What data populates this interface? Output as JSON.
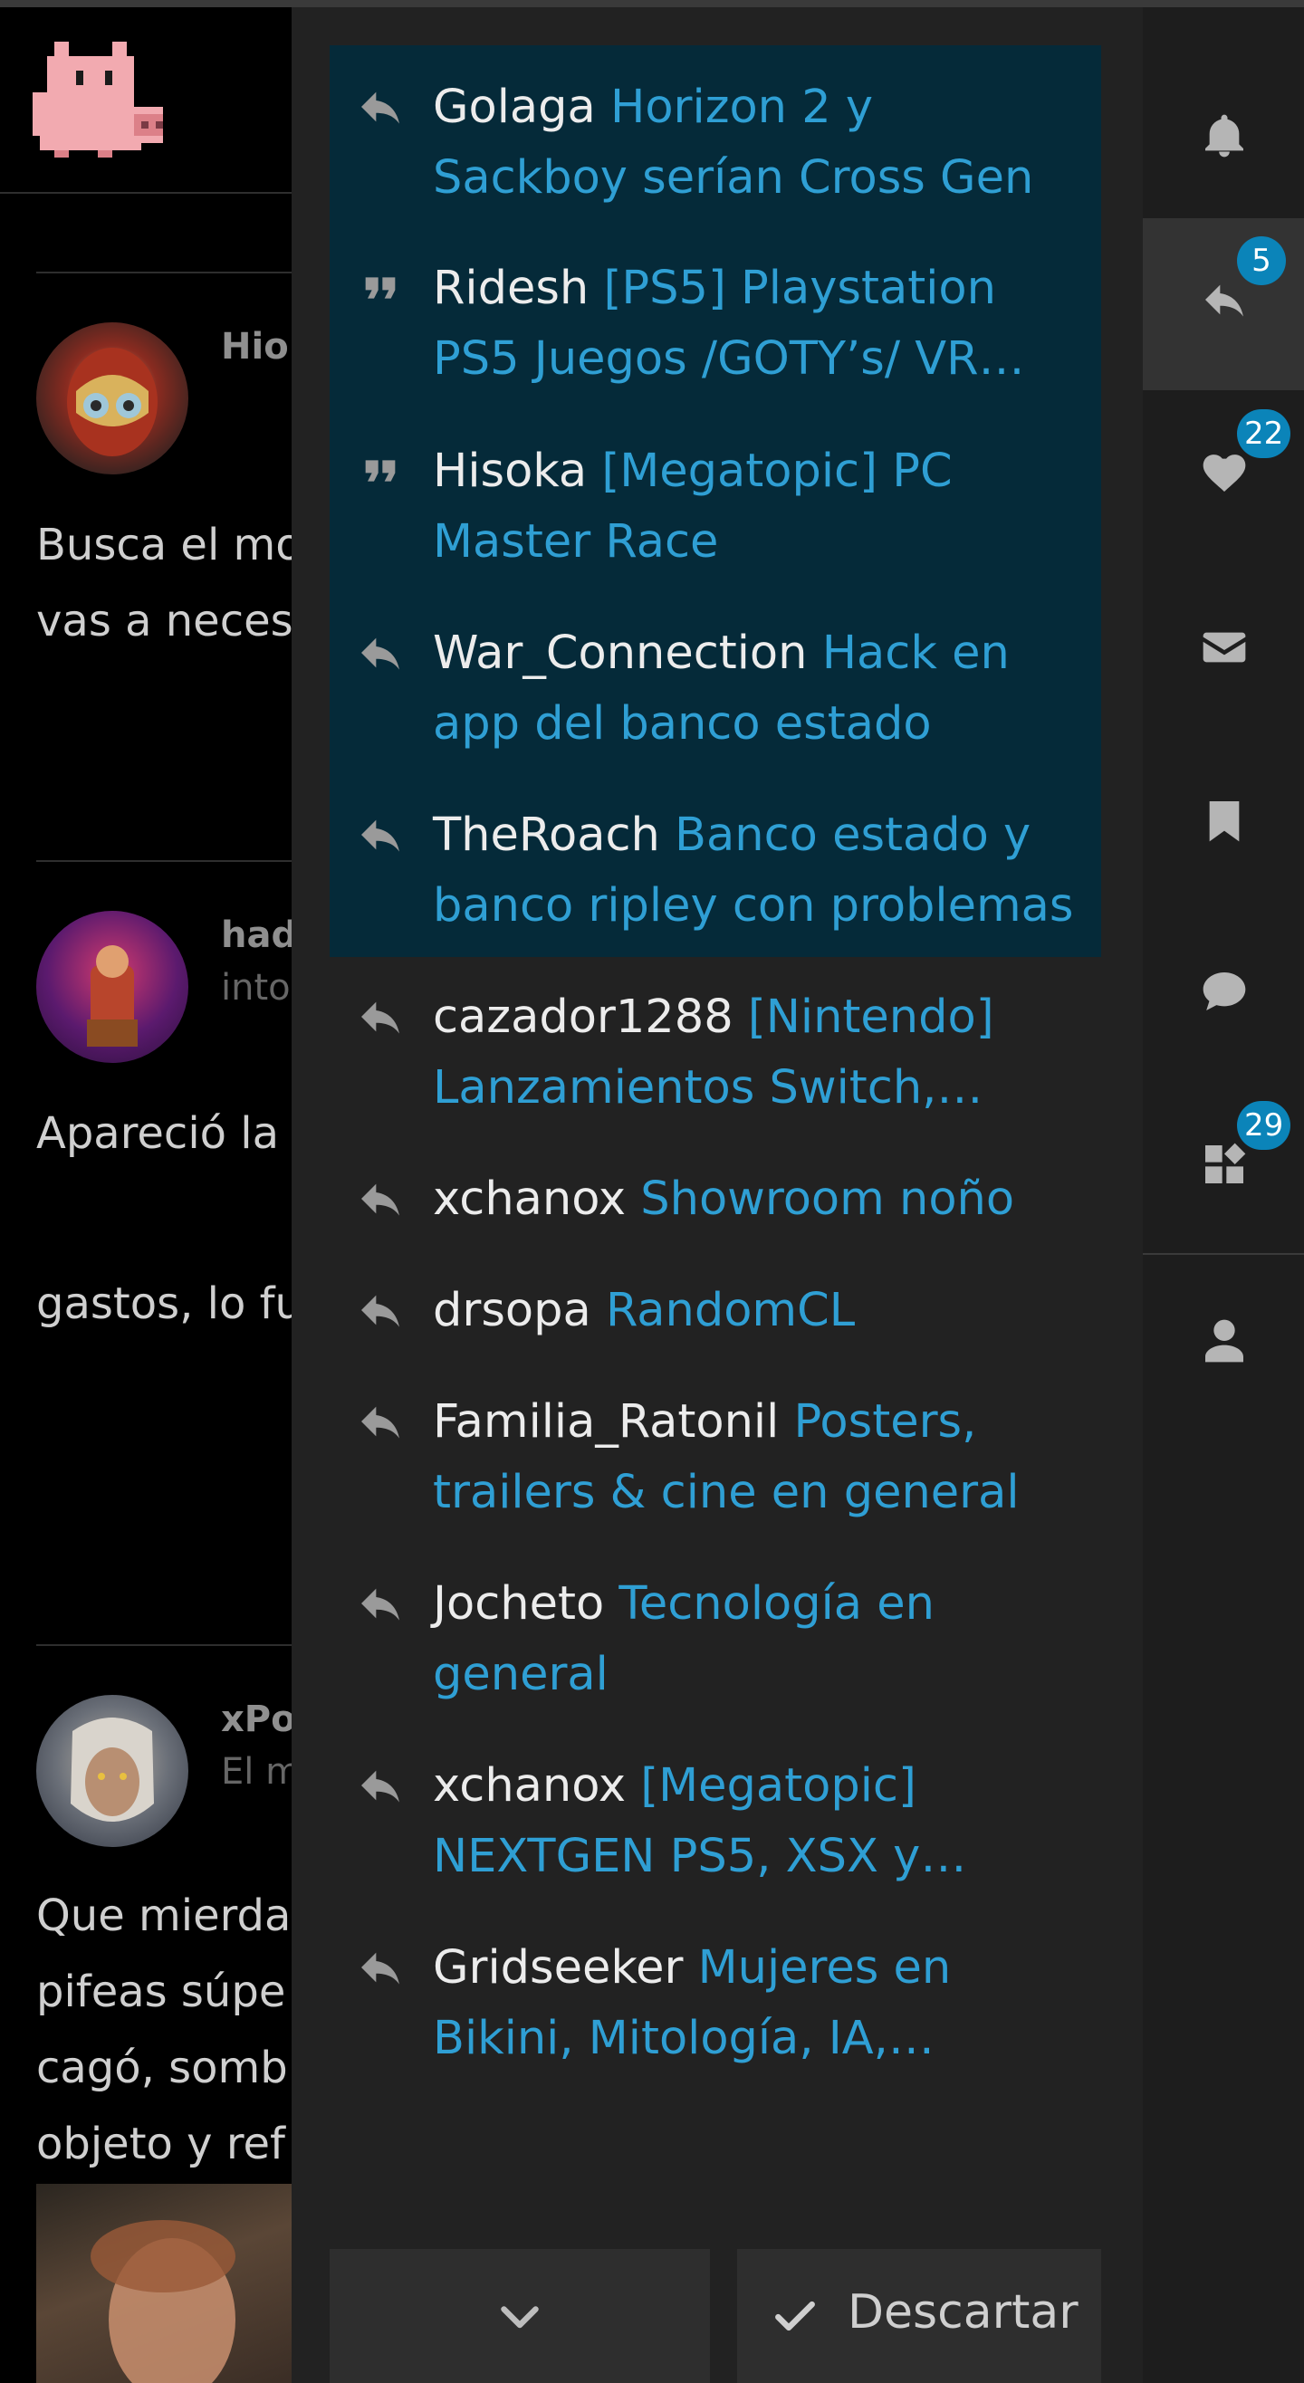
{
  "background": {
    "posts": [
      {
        "username": "Hio",
        "subtitle": "",
        "lines": [
          "Busca el mo",
          "vas a neces"
        ]
      },
      {
        "username": "had",
        "subtitle": "into",
        "lines": [
          "Apareció la",
          "",
          "gastos, lo fu"
        ]
      },
      {
        "username": "xPo",
        "subtitle": "El m",
        "lines": [
          "Que mierda",
          "pifeas súpe",
          "cagó, somb",
          "objeto y ref"
        ]
      }
    ]
  },
  "notifications": [
    {
      "icon": "reply-icon",
      "user": "Golaga",
      "topic": "Horizon 2 y Sackboy serían Cross Gen",
      "unread": true
    },
    {
      "icon": "quote-icon",
      "user": "Ridesh",
      "topic": "[PS5] Playstation",
      "topic2": "PS5 Juegos /GOTY’s/ VR…",
      "unread": true
    },
    {
      "icon": "quote-icon",
      "user": "Hisoka",
      "topic": "[Megatopic] PC Master Race",
      "unread": true
    },
    {
      "icon": "reply-icon",
      "user": "War_Connection",
      "topic": "Hack en app del banco estado",
      "unread": true
    },
    {
      "icon": "reply-icon",
      "user": "TheRoach",
      "topic": "Banco estado y banco ripley con problemas",
      "unread": true
    },
    {
      "icon": "reply-icon",
      "user": "cazador1288",
      "topic": "[Nintendo]",
      "topic2": "Lanzamientos Switch,…",
      "unread": false
    },
    {
      "icon": "reply-icon",
      "user": "xchanox",
      "topic": "Showroom noño",
      "unread": false
    },
    {
      "icon": "reply-icon",
      "user": "drsopa",
      "topic": "RandomCL",
      "unread": false
    },
    {
      "icon": "reply-icon",
      "user": "Familia_Ratonil",
      "topic": "Posters, trailers & cine en general",
      "unread": false
    },
    {
      "icon": "reply-icon",
      "user": "Jocheto",
      "topic": "Tecnología en general",
      "unread": false
    },
    {
      "icon": "reply-icon",
      "user": "xchanox",
      "topic": "[Megatopic]",
      "topic2": "NEXTGEN PS5, XSX y…",
      "unread": false
    },
    {
      "icon": "reply-icon",
      "user": "Gridseeker",
      "topic": "Mujeres en",
      "topic2": "Bikini, Mitología, IA,…",
      "unread": false
    }
  ],
  "footer": {
    "more_icon": "chevron-down-icon",
    "dismiss_label": "Descartar",
    "dismiss_icon": "check-icon"
  },
  "iconbar": [
    {
      "name": "notifications",
      "icon": "bell-icon",
      "badge": ""
    },
    {
      "name": "replies",
      "icon": "reply-icon",
      "badge": "5",
      "active": true
    },
    {
      "name": "likes",
      "icon": "heart-icon",
      "badge": "22"
    },
    {
      "name": "messages",
      "icon": "envelope-icon",
      "badge": ""
    },
    {
      "name": "bookmarks",
      "icon": "bookmark-icon",
      "badge": ""
    },
    {
      "name": "chat",
      "icon": "comment-icon",
      "badge": ""
    },
    {
      "name": "other",
      "icon": "widgets-icon",
      "badge": "29"
    },
    {
      "name": "profile",
      "icon": "user-icon",
      "badge": ""
    }
  ],
  "colors": {
    "panel_bg": "#222222",
    "unread_bg": "#052a39",
    "topic_link": "#2f9fd4",
    "badge_bg": "#0b84b9"
  }
}
